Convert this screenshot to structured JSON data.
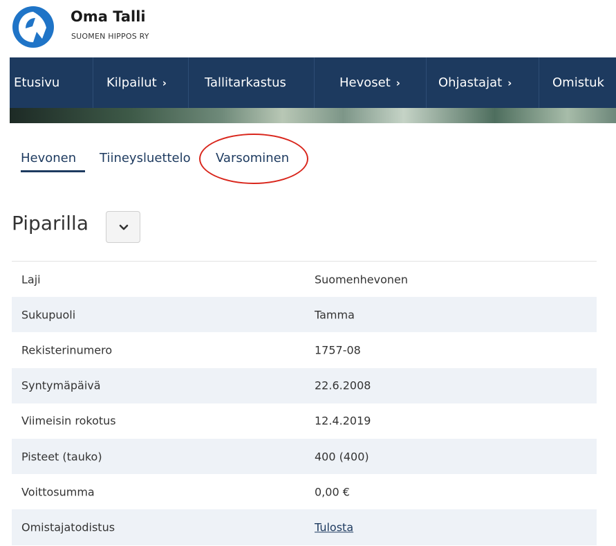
{
  "header": {
    "title": "Oma Talli",
    "subtitle": "SUOMEN HIPPOS RY",
    "logo_icon": "hippos-logo-icon"
  },
  "nav": {
    "items": [
      {
        "label": "Etusivu",
        "chevron": ""
      },
      {
        "label": "Kilpailut",
        "chevron": "›"
      },
      {
        "label": "Tallitarkastus",
        "chevron": ""
      },
      {
        "label": "Hevoset",
        "chevron": "›"
      },
      {
        "label": "Ohjastajat",
        "chevron": "›"
      },
      {
        "label": "Omistuk",
        "chevron": ""
      }
    ]
  },
  "tabs": {
    "items": [
      {
        "label": "Hevonen"
      },
      {
        "label": "Tiineysluettelo"
      },
      {
        "label": "Varsominen"
      }
    ],
    "active": "Hevonen"
  },
  "horse": {
    "name": "Piparilla"
  },
  "details": {
    "rows": [
      {
        "label": "Laji",
        "value": "Suomenhevonen"
      },
      {
        "label": "Sukupuoli",
        "value": "Tamma"
      },
      {
        "label": "Rekisterinumero",
        "value": "1757-08"
      },
      {
        "label": "Syntymäpäivä",
        "value": "22.6.2008"
      },
      {
        "label": "Viimeisin rokotus",
        "value": "12.4.2019"
      },
      {
        "label": "Pisteet (tauko)",
        "value": "400 (400)"
      },
      {
        "label": "Voittosumma",
        "value": "0,00 €"
      },
      {
        "label": "Omistajatodistus",
        "value": "Tulosta"
      }
    ]
  },
  "colors": {
    "nav_bg": "#1d3a5f",
    "accent": "#1d3a5f",
    "row_alt": "#eef2f7",
    "annotation": "#d9261c"
  }
}
